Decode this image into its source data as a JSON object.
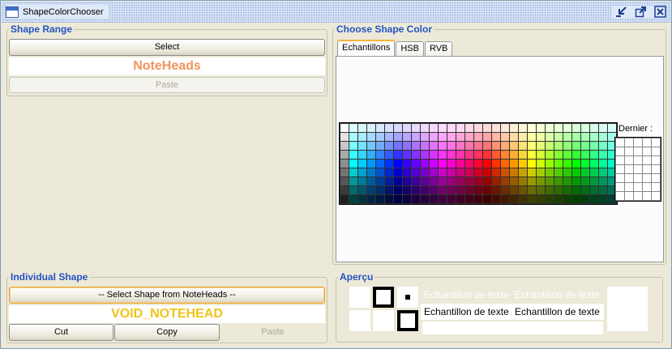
{
  "window": {
    "title": "ShapeColorChooser"
  },
  "title_buttons": {
    "minimize_icon": "minimize-icon",
    "maximize_icon": "maximize-icon",
    "close_icon": "close-icon"
  },
  "shape_range": {
    "legend": "Shape Range",
    "select_label": "Select",
    "range_name": "NoteHeads",
    "range_color": "#f2945c",
    "paste_label": "Paste"
  },
  "individual_shape": {
    "legend": "Individual Shape",
    "select_label": "-- Select Shape from NoteHeads --",
    "shape_name": "VOID_NOTEHEAD",
    "shape_color": "#f0c419",
    "cut_label": "Cut",
    "copy_label": "Copy",
    "paste_label": "Paste"
  },
  "chooser": {
    "legend": "Choose Shape Color",
    "tabs": [
      "Echantillons",
      "HSB",
      "RVB"
    ],
    "selected_tab": "Echantillons",
    "recent_label": "Dernier :"
  },
  "preview": {
    "legend": "Aperçu",
    "sample_text": "Echantillon de texte"
  }
}
